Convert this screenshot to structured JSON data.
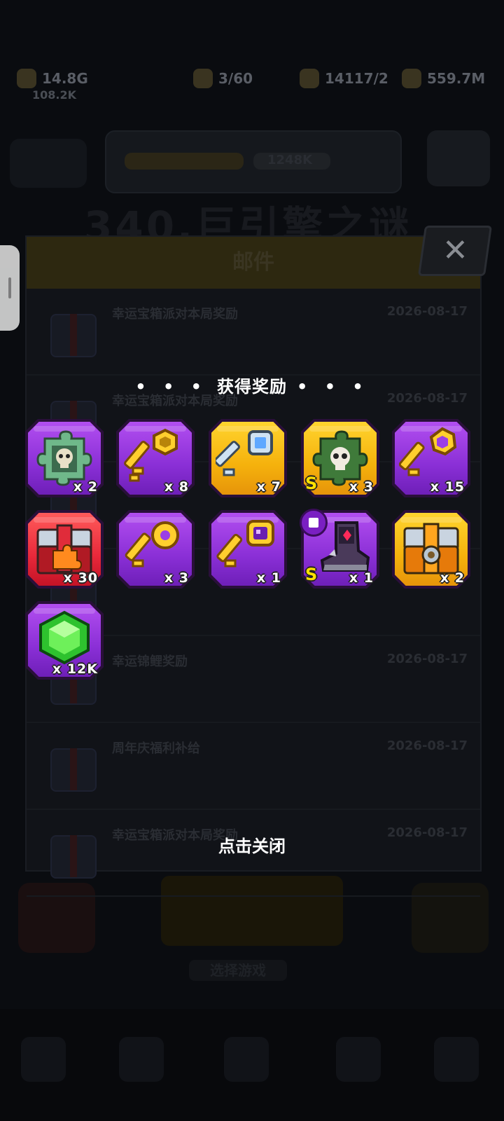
{
  "background": {
    "stats": [
      {
        "value": "14.8G",
        "sub": "108.2K"
      },
      {
        "value": "3/60"
      },
      {
        "value": "14117/2"
      },
      {
        "value": "559.7M"
      }
    ],
    "banner_text": "1248K",
    "big_title": "340.巨引擎之谜",
    "bottom_label": "选择游戏"
  },
  "mail": {
    "title": "邮件",
    "close_symbol": "✕",
    "items": [
      {
        "subject": "幸运宝箱派对本局奖励",
        "date": "2026-08-17"
      },
      {
        "subject": "幸运宝箱派对本局奖励",
        "date": "2026-08-17"
      },
      {
        "subject": "",
        "date": ""
      },
      {
        "subject": "",
        "date": ""
      },
      {
        "subject": "幸运锦鲤奖励",
        "date": "2026-08-17"
      },
      {
        "subject": "周年庆福利补给",
        "date": "2026-08-17"
      },
      {
        "subject": "幸运宝箱派对本局奖励",
        "date": "2026-08-17"
      }
    ]
  },
  "rewards": {
    "title": "获得奖励",
    "title_dots": "• • •",
    "items": [
      {
        "icon": "skull-puzzle-piece-icon",
        "rarity": "purple",
        "qty": "x 2",
        "grade": ""
      },
      {
        "icon": "gold-key-hex-icon",
        "rarity": "purple",
        "qty": "x 8",
        "grade": ""
      },
      {
        "icon": "crystal-key-icon",
        "rarity": "gold",
        "qty": "x 7",
        "grade": ""
      },
      {
        "icon": "skull-puzzle-piece-gold-icon",
        "rarity": "gold",
        "qty": "x 3",
        "grade": "S"
      },
      {
        "icon": "gold-key-gem-icon",
        "rarity": "purple",
        "qty": "x 15",
        "grade": ""
      },
      {
        "icon": "red-puzzle-chest-icon",
        "rarity": "red",
        "qty": "x 30",
        "grade": ""
      },
      {
        "icon": "gold-key-round-icon",
        "rarity": "purple",
        "qty": "x 3",
        "grade": ""
      },
      {
        "icon": "purple-key-icon",
        "rarity": "purple",
        "qty": "x 1",
        "grade": ""
      },
      {
        "icon": "armored-boot-icon",
        "rarity": "purple",
        "qty": "x 1",
        "grade": "S"
      },
      {
        "icon": "gold-chest-icon",
        "rarity": "gold",
        "qty": "x 2",
        "grade": ""
      },
      {
        "icon": "green-gem-icon",
        "rarity": "purple",
        "qty": "x 12K",
        "grade": ""
      }
    ],
    "close_hint": "点击关闭"
  },
  "colors": {
    "purple": "#9b3ee6",
    "gold": "#f5b10c",
    "red": "#e8283a",
    "overlay": "#0a0c10"
  }
}
